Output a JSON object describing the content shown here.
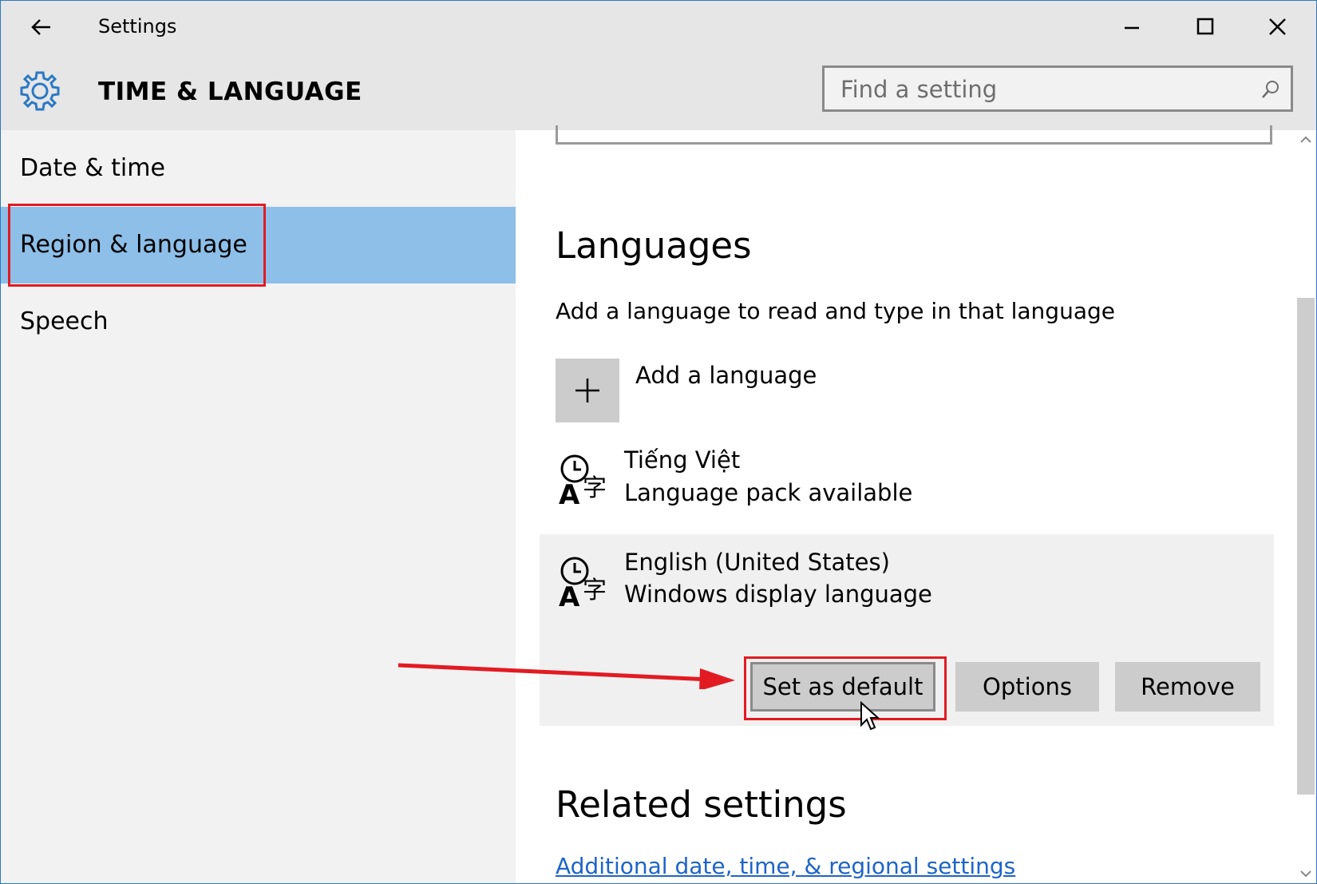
{
  "window": {
    "title": "Settings",
    "section_title": "TIME & LANGUAGE",
    "controls": [
      "minimize-icon",
      "maximize-icon",
      "close-icon"
    ]
  },
  "search": {
    "placeholder": "Find a setting",
    "value": ""
  },
  "sidebar": {
    "items": [
      {
        "label": "Date & time",
        "selected": false
      },
      {
        "label": "Region & language",
        "selected": true
      },
      {
        "label": "Speech",
        "selected": false
      }
    ]
  },
  "languages": {
    "heading": "Languages",
    "description": "Add a language to read and type in that language",
    "add_label": "Add a language",
    "items": [
      {
        "name": "Tiếng Việt",
        "status": "Language pack available",
        "icon": "language-pack-icon"
      },
      {
        "name": "English (United States)",
        "status": "Windows display language",
        "icon": "language-pack-icon"
      }
    ],
    "actions": {
      "set_default": "Set as default",
      "options": "Options",
      "remove": "Remove"
    }
  },
  "related": {
    "heading": "Related settings",
    "link": "Additional date, time, & regional settings"
  },
  "colors": {
    "accent": "#2b79c4",
    "selected_nav": "#8dbfe8",
    "annotation": "#e21b23",
    "link": "#1e64c8"
  }
}
